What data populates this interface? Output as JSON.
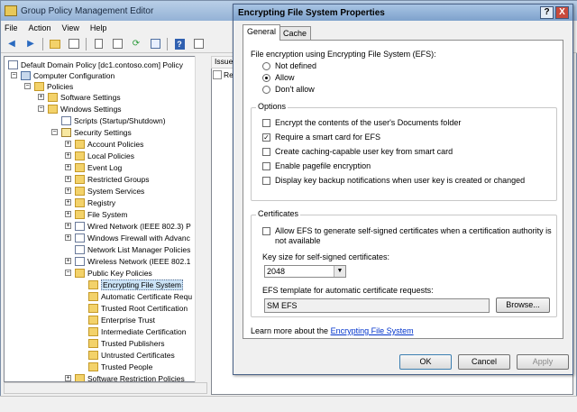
{
  "main_window": {
    "title": "Group Policy Management Editor",
    "menu": [
      "File",
      "Action",
      "View",
      "Help"
    ],
    "tree": {
      "items": [
        {
          "label": "Default Domain Policy [dc1.contoso.com] Policy"
        },
        {
          "label": "Computer Configuration"
        },
        {
          "label": "Policies"
        },
        {
          "label": "Software Settings"
        },
        {
          "label": "Windows Settings"
        },
        {
          "label": "Scripts (Startup/Shutdown)"
        },
        {
          "label": "Security Settings"
        },
        {
          "label": "Account Policies"
        },
        {
          "label": "Local Policies"
        },
        {
          "label": "Event Log"
        },
        {
          "label": "Restricted Groups"
        },
        {
          "label": "System Services"
        },
        {
          "label": "Registry"
        },
        {
          "label": "File System"
        },
        {
          "label": "Wired Network (IEEE 802.3) P"
        },
        {
          "label": "Windows Firewall with Advanc"
        },
        {
          "label": "Network List Manager Policies"
        },
        {
          "label": "Wireless Network (IEEE 802.1"
        },
        {
          "label": "Public Key Policies"
        },
        {
          "label": "Encrypting File System"
        },
        {
          "label": "Automatic Certificate Requ"
        },
        {
          "label": "Trusted Root Certification"
        },
        {
          "label": "Enterprise Trust"
        },
        {
          "label": "Intermediate Certification"
        },
        {
          "label": "Trusted Publishers"
        },
        {
          "label": "Untrusted Certificates"
        },
        {
          "label": "Trusted People"
        },
        {
          "label": "Software Restriction Policies"
        }
      ]
    },
    "right_pane": {
      "column_header": "Issue",
      "row_fragment": "Re"
    }
  },
  "dialog": {
    "title": "Encrypting File System Properties",
    "help_glyph": "?",
    "close_glyph": "X",
    "tabs": [
      "General",
      "Cache"
    ],
    "efs_label": "File encryption using Encrypting File System (EFS):",
    "radios": [
      {
        "label": "Not defined",
        "checked": false
      },
      {
        "label": "Allow",
        "checked": true
      },
      {
        "label": "Don't allow",
        "checked": false
      }
    ],
    "options_title": "Options",
    "options": [
      {
        "label": "Encrypt the contents of the user's Documents folder",
        "checked": false
      },
      {
        "label": "Require a smart card for EFS",
        "checked": true
      },
      {
        "label": "Create caching-capable user key from smart card",
        "checked": false
      },
      {
        "label": "Enable pagefile encryption",
        "checked": false
      },
      {
        "label": "Display key backup notifications when user key is created or changed",
        "checked": false
      }
    ],
    "certificates_title": "Certificates",
    "allow_self_signed_line1": "Allow EFS to generate self-signed certificates when a certification authority is",
    "allow_self_signed_line2": "not available",
    "key_size_label": "Key size for self-signed certificates:",
    "key_size_value": "2048",
    "template_label": "EFS template for automatic certificate requests:",
    "template_value": "SM EFS",
    "browse_label": "Browse...",
    "learn_prefix": "Learn more about the ",
    "learn_link": "Encrypting File System",
    "ok_label": "OK",
    "cancel_label": "Cancel",
    "apply_label": "Apply"
  }
}
